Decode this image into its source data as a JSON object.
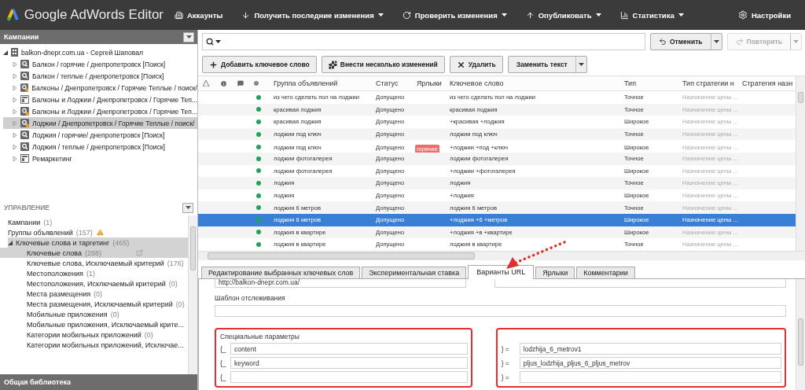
{
  "app": {
    "title": "Google AdWords Editor"
  },
  "menu": [
    {
      "label": "Аккаунты",
      "kind": "accounts",
      "dropdown": false
    },
    {
      "label": "Получить последние изменения",
      "kind": "download",
      "dropdown": true
    },
    {
      "label": "Проверить изменения",
      "kind": "check",
      "dropdown": true
    },
    {
      "label": "Опубликовать",
      "kind": "publish",
      "dropdown": true
    },
    {
      "label": "Статистика",
      "kind": "stats",
      "dropdown": true
    }
  ],
  "settings": {
    "label": "Настройки"
  },
  "campaigns_panel": {
    "title": "Кампании",
    "account": "balkon-dnepr.com.ua - Сергей Шаповал",
    "campaigns": [
      {
        "name": "Балкон  / горячие / днепропетровск [Поиск]",
        "kind": "search",
        "marked": false,
        "selected": false
      },
      {
        "name": "Балкон / теплые / днепропетровск [Поиск]",
        "kind": "search",
        "marked": false,
        "selected": false
      },
      {
        "name": "Балконы / Днепропетровск / Горячие Теплые / поиск/",
        "kind": "search",
        "marked": true,
        "selected": false
      },
      {
        "name": "Балконы и Лоджии / Днепропетровск / Горячие Теп...",
        "kind": "display",
        "marked": false,
        "selected": false
      },
      {
        "name": "Балконы и Лоджии / Днепропетровск / Горячие Теп...",
        "kind": "search",
        "marked": true,
        "selected": false
      },
      {
        "name": "Лоджии / Днепропетровск / Горячие Теплые / поиск/",
        "kind": "search",
        "marked": true,
        "selected": true
      },
      {
        "name": "Лоджия / горячие/ днепропетровск [Поиск]",
        "kind": "search",
        "marked": false,
        "selected": false
      },
      {
        "name": "Лоджия / теплые / днепропетровск [Поиск]",
        "kind": "search",
        "marked": false,
        "selected": false
      },
      {
        "name": "Ремаркетинг",
        "kind": "display",
        "marked": false,
        "selected": false
      }
    ]
  },
  "management": {
    "title": "УПРАВЛЕНИЕ",
    "items": [
      {
        "label": "Кампании",
        "count": "(1)",
        "selected": false,
        "warning": false
      },
      {
        "label": "Группы объявлений",
        "count": "(157)",
        "selected": false,
        "warning": true
      },
      {
        "label": "Ключевые слова и таргетинг",
        "count": "(465)",
        "selected": true,
        "warning": false,
        "expanded": true,
        "children": [
          {
            "label": "Ключевые слова",
            "count": "(288)",
            "selected": true
          },
          {
            "label": "Ключевые слова, Исключаемый критерий",
            "count": "(176)",
            "selected": false
          },
          {
            "label": "Местоположения",
            "count": "(1)",
            "selected": false
          },
          {
            "label": "Местоположения, Исключаемый критерий",
            "count": "(0)",
            "selected": false
          },
          {
            "label": "Места размещения",
            "count": "(0)",
            "selected": false
          },
          {
            "label": "Места размещения, Исключаемый критерий",
            "count": "(0)",
            "selected": false
          },
          {
            "label": "Мобильные приложения",
            "count": "(0)",
            "selected": false
          },
          {
            "label": "Мобильные приложения, Исключаемый крите...",
            "selected": false
          },
          {
            "label": "Категории мобильных приложений",
            "count": "(0)",
            "selected": false
          },
          {
            "label": "Категории мобильных приложений, Исключае...",
            "selected": false
          }
        ]
      }
    ]
  },
  "library": {
    "title": "Общая библиотека"
  },
  "history_buttons": [
    {
      "label": "Отменить",
      "kind": "undo",
      "disabled": false
    },
    {
      "label": "Повторить",
      "kind": "redo",
      "disabled": true
    }
  ],
  "toolbar": [
    {
      "label": "Добавить ключевое слово",
      "kind": "add"
    },
    {
      "label": "Внести несколько изменений",
      "kind": "multi"
    },
    {
      "label": "Удалить",
      "kind": "delete"
    },
    {
      "label": "Заменить текст",
      "kind": "replace"
    }
  ],
  "table": {
    "columns": [
      "Группа объявлений",
      "Статус",
      "Ярлыки",
      "Ключевое слово",
      "Тип",
      "Тип стратегии н",
      "Стратегия назн"
    ],
    "rows": [
      {
        "group": "из чего сделать пол на лоджии",
        "status": "Допущено",
        "keyword": "из чего сделать пол на лоджии",
        "type": "Точное",
        "strategy": "Назначение цены ...",
        "selected": false
      },
      {
        "group": "красивая лоджия",
        "status": "Допущено",
        "keyword": "красивая лоджия",
        "type": "Точное",
        "strategy": "Назначение цены ...",
        "selected": false
      },
      {
        "group": "красивая лоджия",
        "status": "Допущено",
        "keyword": "+красивая +лоджия",
        "type": "Широкое",
        "strategy": "Назначение цены ...",
        "selected": false
      },
      {
        "group": "лоджии под ключ",
        "status": "Допущено",
        "keyword": "лоджии под ключ",
        "type": "Точное",
        "strategy": "Назначение цены ...",
        "selected": false
      },
      {
        "group": "лоджии под ключ",
        "status": "Допущено",
        "labels": [
          {
            "text": "горячие",
            "color": "#f26b6b"
          }
        ],
        "keyword": "+лоджии +под +ключ",
        "type": "Широкое",
        "strategy": "Назначение цены ...",
        "selected": false
      },
      {
        "group": "лоджии фотогалерея",
        "status": "Допущено",
        "keyword": "лоджии фотогалерея",
        "type": "Точное",
        "strategy": "Назначение цены ...",
        "selected": false
      },
      {
        "group": "лоджии фотогалерея",
        "status": "Допущено",
        "keyword": "+лоджии +фотогалерея",
        "type": "Широкое",
        "strategy": "Назначение цены ...",
        "selected": false
      },
      {
        "group": "лоджия",
        "status": "Допущено",
        "keyword": "лоджия",
        "type": "Точное",
        "strategy": "Назначение цены ...",
        "selected": false
      },
      {
        "group": "лоджия",
        "status": "Допущено",
        "keyword": "+лоджия",
        "type": "Широкое",
        "strategy": "Назначение цены ...",
        "selected": false
      },
      {
        "group": "лоджия 6 метров",
        "status": "Допущено",
        "keyword": "лоджия 6 метров",
        "type": "Точное",
        "strategy": "Назначение цены ...",
        "selected": false
      },
      {
        "group": "лоджия 6 метров",
        "status": "Допущено",
        "keyword": "+лоджия +6 +метров",
        "type": "Широкое",
        "strategy": "Назначение цены ...",
        "selected": true
      },
      {
        "group": "лоджия в квартире",
        "status": "Допущено",
        "keyword": "+лоджия +в +квартире",
        "type": "Широкое",
        "strategy": "Назначение цены ...",
        "selected": false
      },
      {
        "group": "лоджия в квартире",
        "status": "Допущено",
        "keyword": "лоджия в квартире",
        "type": "Точное",
        "strategy": "Назначение цены ...",
        "selected": false
      }
    ]
  },
  "tabs": [
    {
      "label": "Редактирование выбранных ключевых слов",
      "selected": false
    },
    {
      "label": "Экспериментальная ставка",
      "selected": false
    },
    {
      "label": "Варианты URL",
      "selected": true
    },
    {
      "label": "Ярлыки",
      "selected": false
    },
    {
      "label": "Комментарии",
      "selected": false
    }
  ],
  "url_panel": {
    "final_url": "http://balkon-dnepr.com.ua/",
    "tracking_label": "Шаблон отслеживания",
    "params_label": "Специальные параметры",
    "params": [
      {
        "open": "{_",
        "name": "content",
        "close": "} =",
        "value": "lodzhija_6_metrov1"
      },
      {
        "open": "{_",
        "name": "keyword",
        "close": "} =",
        "value": "pljus_lodzhija_pljus_6_pljus_metrov"
      },
      {
        "open": "{_",
        "close": "} ="
      }
    ]
  }
}
